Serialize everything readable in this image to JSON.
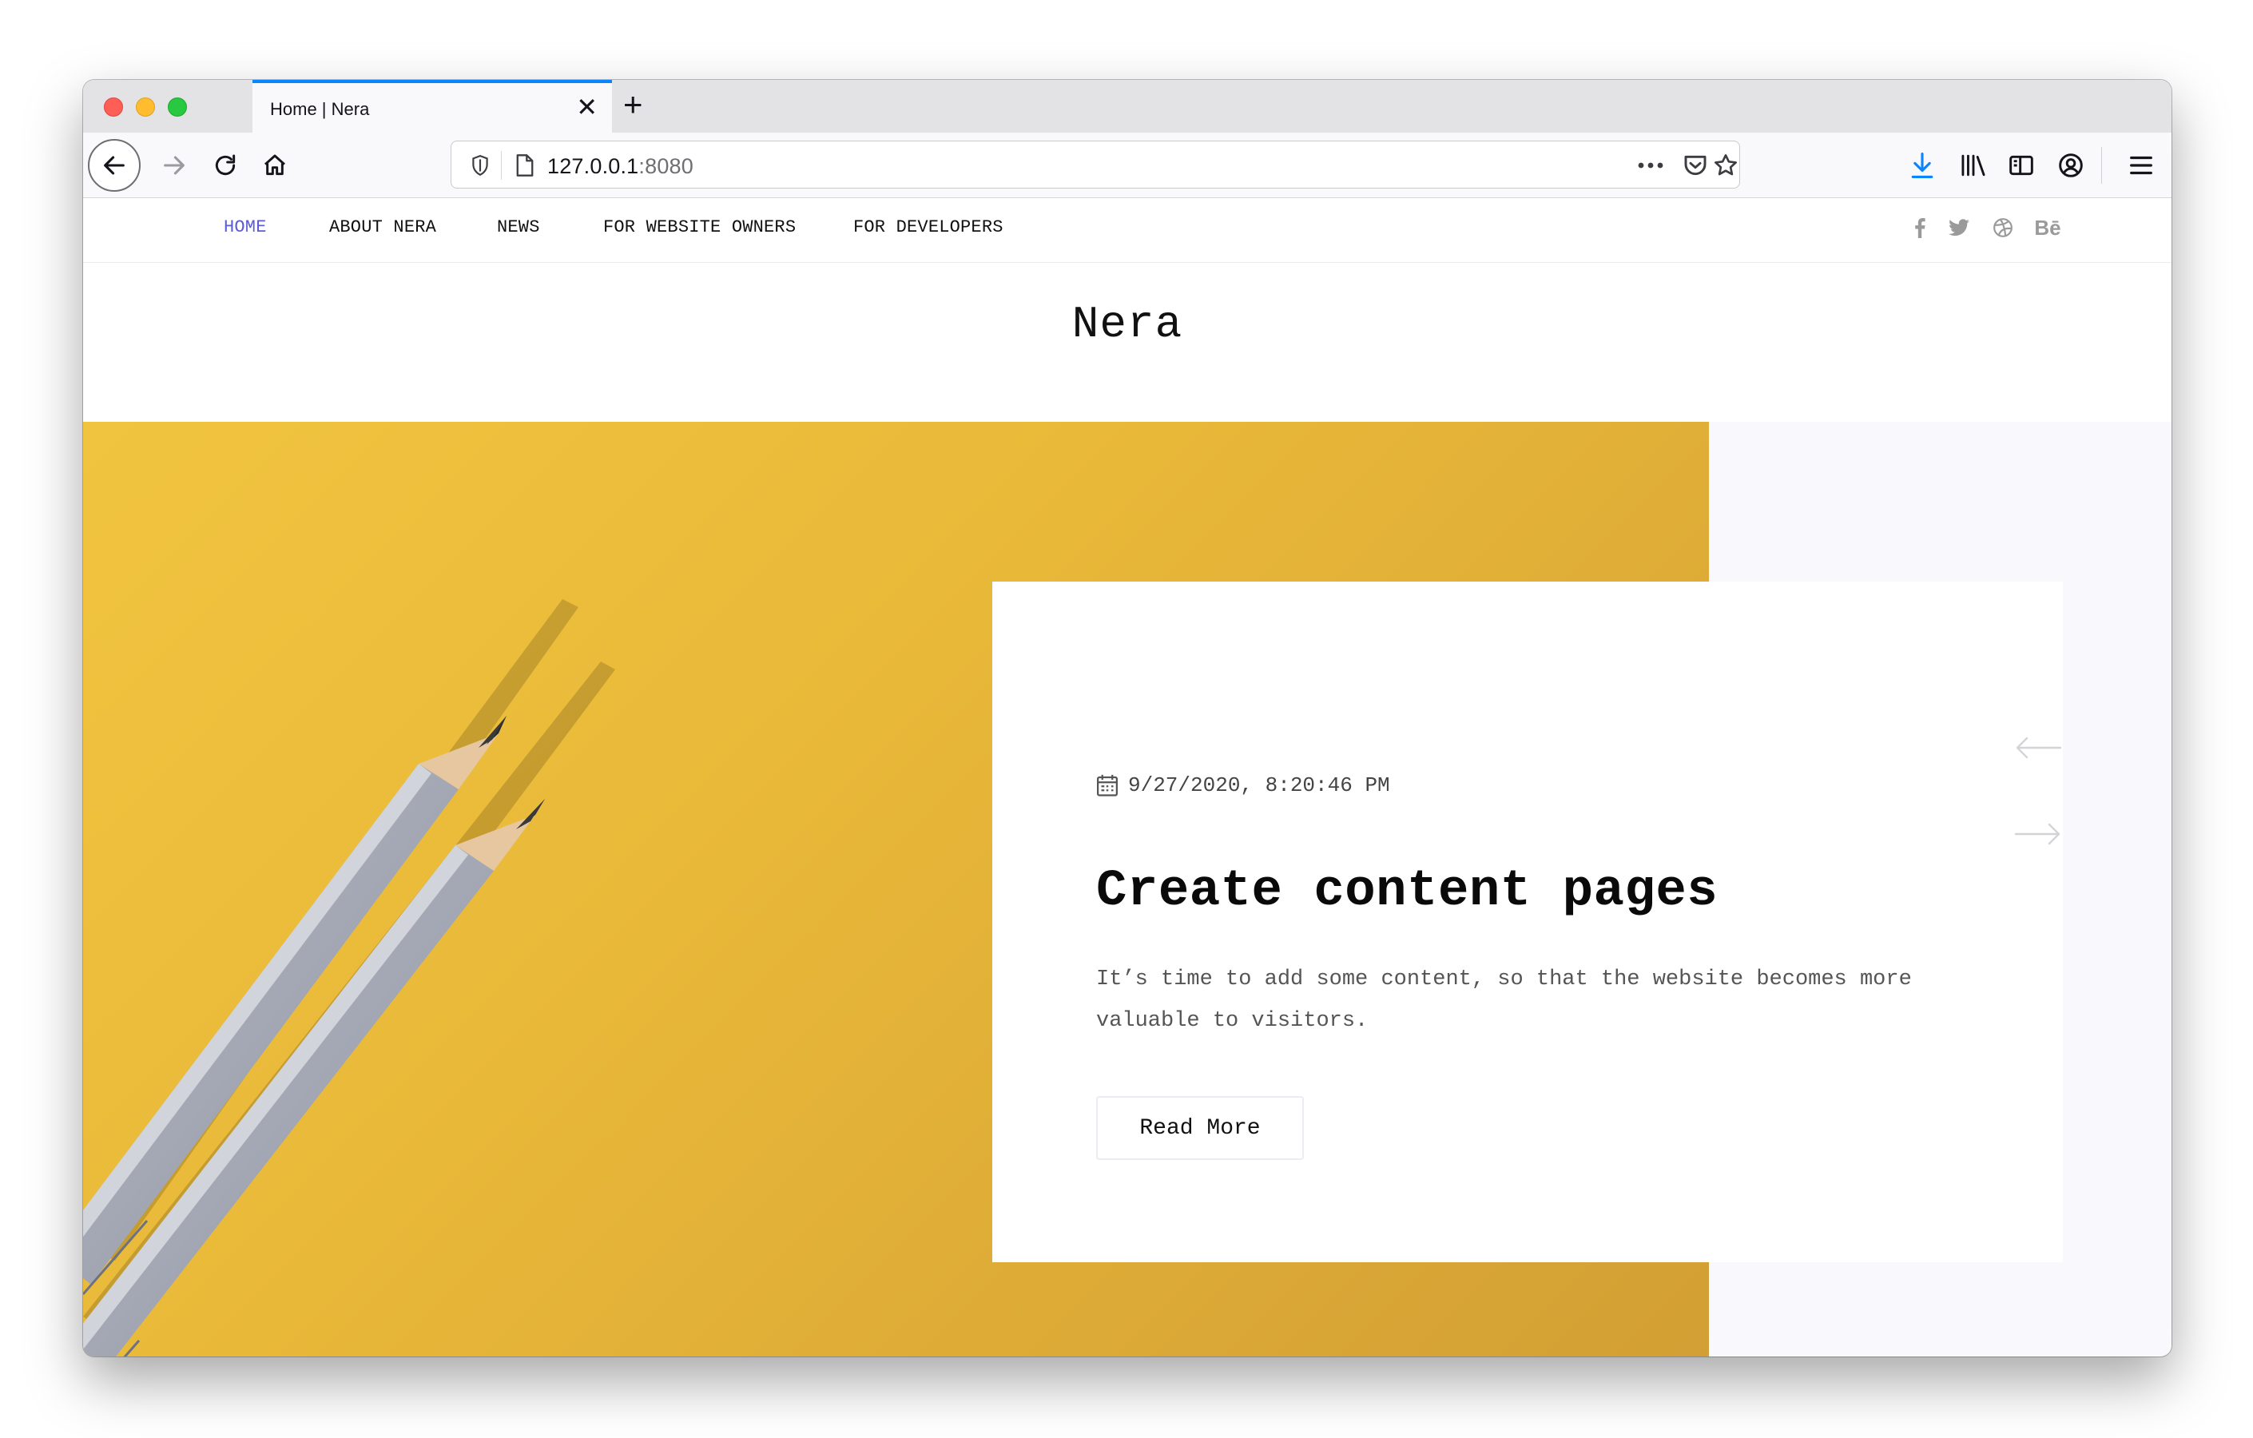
{
  "browser": {
    "tab_title": "Home | Nera",
    "url_host": "127.0.0.1",
    "url_port": ":8080",
    "accent_color": "#0a84ff"
  },
  "site": {
    "title": "Nera",
    "nav": {
      "home": "HOME",
      "about": "ABOUT NERA",
      "news": "NEWS",
      "owners": "FOR WEBSITE OWNERS",
      "developers": "FOR DEVELOPERS"
    },
    "active_color": "#5b5bd6",
    "social": {
      "behance": "Bē"
    }
  },
  "hero": {
    "date": "9/27/2020, 8:20:46 PM",
    "title": "Create content pages",
    "text": "It’s time to add some content, so that the website becomes more valuable to visitors.",
    "button": "Read More",
    "image_color": "#f1c43f"
  }
}
